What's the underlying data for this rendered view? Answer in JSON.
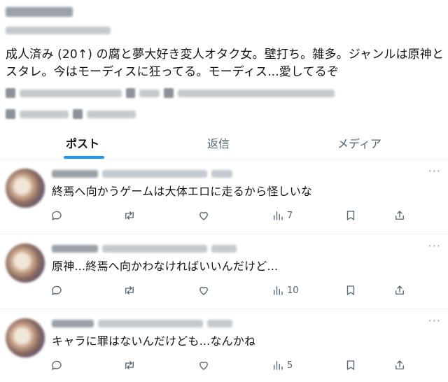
{
  "profile": {
    "bio": "成人済み (20↑) の腐と夢大好き変人オタク女。壁打ち。雑多。ジャンルは原神とスタレ。今はモーディスに狂ってる。モーディス...愛してるぞ"
  },
  "tabs": [
    {
      "label": "ポスト",
      "active": true
    },
    {
      "label": "返信",
      "active": false
    },
    {
      "label": "メディア",
      "active": false
    }
  ],
  "tweets": [
    {
      "text": "終焉へ向かうゲームは大体エロに走るから怪しいな",
      "views": "7",
      "more": "···"
    },
    {
      "text": "原神...終焉へ向かわなければいいんだけど...",
      "views": "10",
      "more": "···"
    },
    {
      "text": "キャラに罪はないんだけども...なんかね",
      "views": "5",
      "more": "···"
    }
  ],
  "icons": {
    "reply": "reply-icon",
    "retweet": "retweet-icon",
    "like": "heart-icon",
    "views": "views-chart-icon",
    "bookmark": "bookmark-icon",
    "share": "share-icon"
  },
  "colors": {
    "accent": "#1d9bf0",
    "text": "#0f1419",
    "secondary": "#536471",
    "divider": "#eff3f4"
  }
}
